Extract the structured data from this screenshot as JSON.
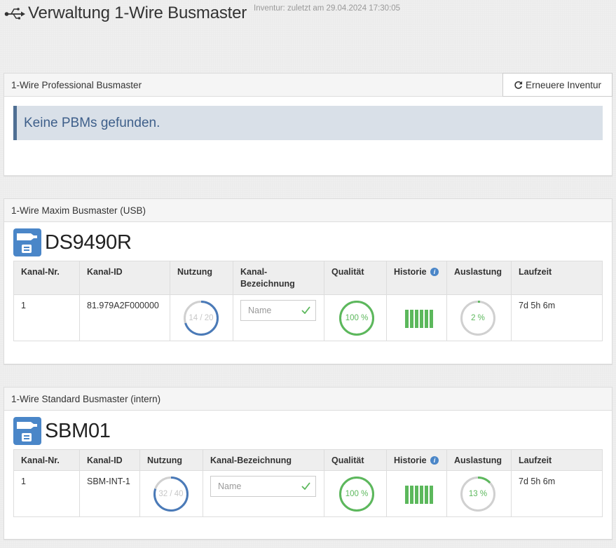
{
  "page": {
    "title": "Verwaltung 1-Wire Busmaster",
    "inventory_note": "Inventur: zuletzt am 29.04.2024 17:30:05"
  },
  "pbm": {
    "heading": "1-Wire Professional Busmaster",
    "refresh_label": "Erneuere Inventur",
    "alert": "Keine PBMs gefunden."
  },
  "usb": {
    "heading": "1-Wire Maxim Busmaster (USB)",
    "device_name": "DS9490R",
    "columns": {
      "kanal_nr": "Kanal-Nr.",
      "kanal_id": "Kanal-ID",
      "nutzung": "Nutzung",
      "bezeichnung": "Kanal-Bezeichnung",
      "qualitaet": "Qualität",
      "historie": "Historie",
      "auslastung": "Auslastung",
      "laufzeit": "Laufzeit"
    },
    "row": {
      "kanal_nr": "1",
      "kanal_id": "81.979A2F000000",
      "usage_label": "14 / 20",
      "usage_fraction": 0.7,
      "name_placeholder": "Name",
      "quality_label": "100 %",
      "quality_fraction": 1.0,
      "history_bars": 6,
      "load_label": "2 %",
      "load_fraction": 0.02,
      "uptime": "7d 5h 6m"
    }
  },
  "sbm": {
    "heading": "1-Wire Standard Busmaster (intern)",
    "device_name": "SBM01",
    "columns": {
      "kanal_nr": "Kanal-Nr.",
      "kanal_id": "Kanal-ID",
      "nutzung": "Nutzung",
      "bezeichnung": "Kanal-Bezeichnung",
      "qualitaet": "Qualität",
      "historie": "Historie",
      "auslastung": "Auslastung",
      "laufzeit": "Laufzeit"
    },
    "row": {
      "kanal_nr": "1",
      "kanal_id": "SBM-INT-1",
      "usage_label": "32 / 40",
      "usage_fraction": 0.8,
      "name_placeholder": "Name",
      "quality_label": "100 %",
      "quality_fraction": 1.0,
      "history_bars": 6,
      "load_label": "13 %",
      "load_fraction": 0.13,
      "uptime": "7d 5h 6m"
    }
  },
  "colors": {
    "usage_ring": "#4a7ab8",
    "quality_ring": "#5cb85c",
    "load_ring": "#5cb85c",
    "ring_track": "#d0d0d0",
    "alert_text": "#3e5f8a",
    "device_icon": "#4a86c8"
  },
  "icons": {
    "header": "usb-icon",
    "refresh": "refresh-icon",
    "device": "busmaster-device-icon",
    "info": "info-icon",
    "valid": "check-icon"
  }
}
